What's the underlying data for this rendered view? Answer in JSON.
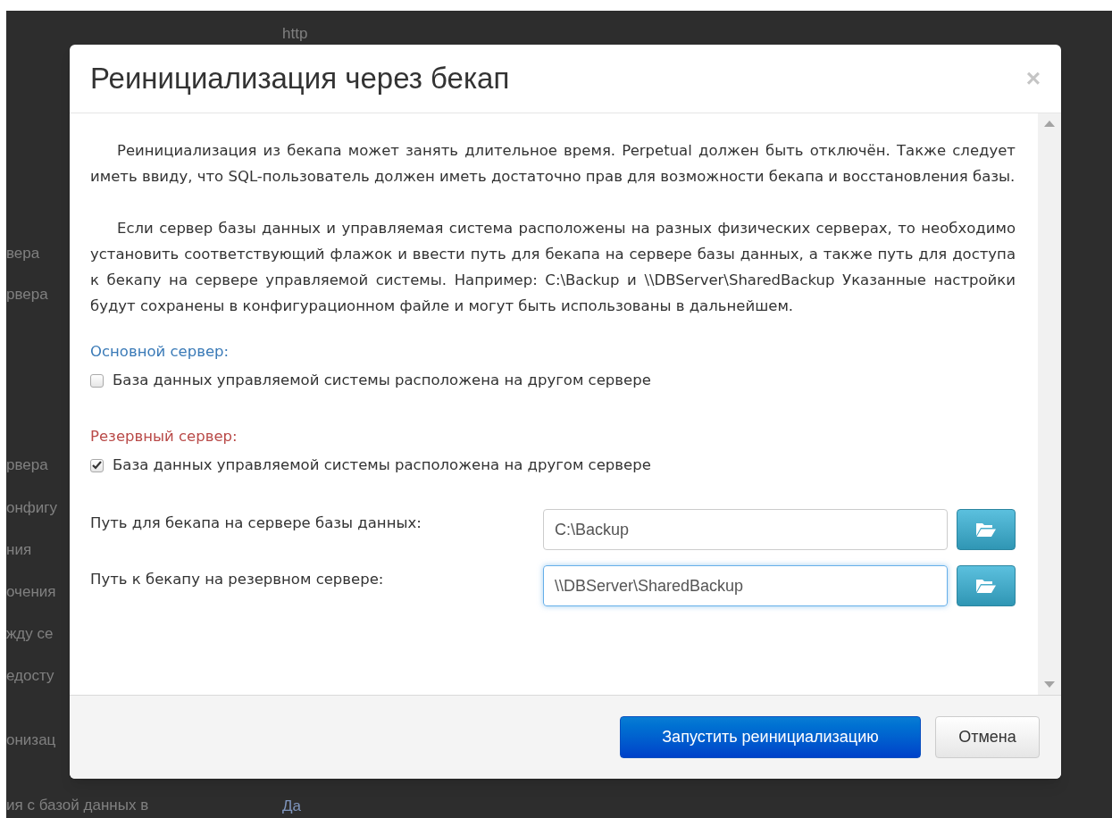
{
  "background_page": {
    "top_text": "http",
    "side_labels": [
      "вера",
      "рвера",
      "рвера",
      "онфигу",
      "ния",
      "очения",
      "жду се",
      "едосту",
      "онизац"
    ],
    "bottom_label": "ия с базой данных в",
    "bottom_value": "Да"
  },
  "dialog": {
    "title": "Реинициализация через бекап",
    "close": "×",
    "paragraphs": [
      "Реинициализация из бекапа может занять длительное время. Perpetual должен быть отключён. Также следует иметь ввиду, что SQL-пользователь должен иметь достаточно прав для возможности бекапа и восстановления базы.",
      "Если сервер базы данных и управляемая система расположены на разных физических серверах, то необходимо установить соответствующий флажок и ввести путь для бекапа на сервере базы данных, а также путь для доступа к бекапу на сервере управляемой системы. Например: C:\\Backup и \\\\DBServer\\SharedBackup Указанные настройки будут сохранены в конфигурационном файле и могут быть использованы в дальнейшем."
    ],
    "sections": [
      {
        "kind": "primary",
        "heading": "Основной сервер:",
        "checkbox": {
          "label": "База данных управляемой системы расположена на другом сервере",
          "checked": false
        }
      },
      {
        "kind": "backup",
        "heading": "Резервный сервер:",
        "checkbox": {
          "label": "База данных управляемой системы расположена на другом сервере",
          "checked": true
        }
      }
    ],
    "fields": [
      {
        "label": "Путь для бекапа на сервере базы данных:",
        "value": "C:\\Backup",
        "focused": false
      },
      {
        "label": "Путь к бекапу на резервном сервере:",
        "value": "\\\\DBServer\\SharedBackup",
        "focused": true
      }
    ],
    "buttons": [
      {
        "label": "Запустить реинициализацию",
        "kind": "primary"
      },
      {
        "label": "Отмена",
        "kind": "default"
      }
    ]
  }
}
